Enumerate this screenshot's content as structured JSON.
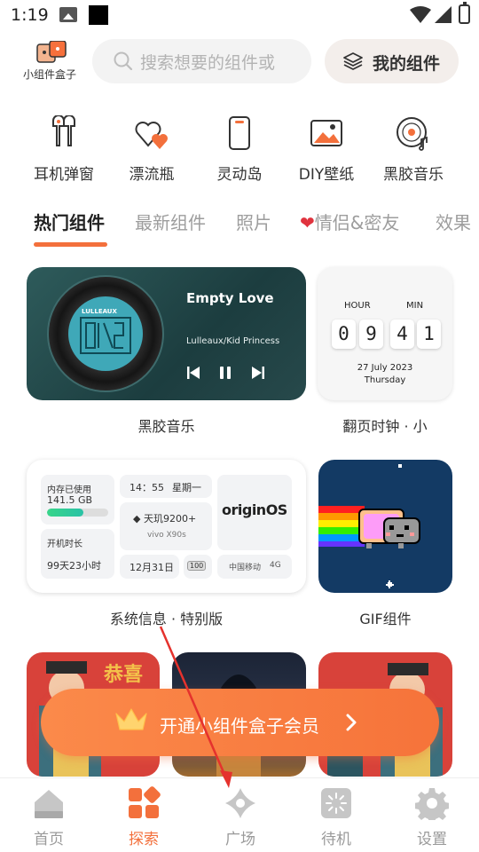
{
  "status_bar": {
    "time": "1:19"
  },
  "header": {
    "logo_label": "小组件盒子",
    "search_placeholder": "搜索想要的组件或",
    "my_widgets_label": "我的组件"
  },
  "categories": [
    {
      "label": "耳机弹窗",
      "icon": "earbuds-icon"
    },
    {
      "label": "漂流瓶",
      "icon": "hearts-icon"
    },
    {
      "label": "灵动岛",
      "icon": "phone-icon"
    },
    {
      "label": "DIY壁纸",
      "icon": "picture-icon"
    },
    {
      "label": "黑胶音乐",
      "icon": "vinyl-record-icon"
    }
  ],
  "tabs": [
    {
      "label": "热门组件",
      "active": true
    },
    {
      "label": "最新组件",
      "active": false
    },
    {
      "label": "照片",
      "active": false
    },
    {
      "label": "情侣&密友",
      "active": false
    },
    {
      "label": "效果",
      "active": false
    }
  ],
  "widgets": {
    "music": {
      "caption": "黑胶音乐",
      "song": "Empty Love",
      "artist": "Lulleaux/Kid Princess",
      "cover_text": "LULLEAUX"
    },
    "flip_clock": {
      "caption": "翻页时钟 · 小",
      "hour_label": "HOUR",
      "min_label": "MIN",
      "digits": [
        "0",
        "9",
        "4",
        "1"
      ],
      "date": "27 July 2023",
      "weekday": "Thursday"
    },
    "sys_info": {
      "caption": "系统信息 · 特别版",
      "storage_label": "内存已使用",
      "storage_value": "141.5 GB",
      "storage_fill": 0.6,
      "uptime_label": "开机时长",
      "uptime_value": "99天23小时",
      "time": "14：55",
      "weekday": "星期一",
      "chip": "天玑9200+",
      "device": "vivo X90s",
      "brand": "originOS",
      "date": "12月31日",
      "battery": "100",
      "carrier": "中国移动",
      "network": "4G"
    },
    "gif": {
      "caption": "GIF组件"
    },
    "row3_left_text": "恭喜"
  },
  "vip_banner": {
    "label": "开通小组件盒子会员"
  },
  "bottom_nav": [
    {
      "label": "首页",
      "icon": "home-icon",
      "active": false
    },
    {
      "label": "探索",
      "icon": "explore-grid-icon",
      "active": true
    },
    {
      "label": "广场",
      "icon": "plaza-icon",
      "active": false
    },
    {
      "label": "待机",
      "icon": "standby-icon",
      "active": false
    },
    {
      "label": "设置",
      "icon": "settings-gear-icon",
      "active": false
    }
  ],
  "colors": {
    "accent": "#f3703c",
    "music_bg": "#23494b",
    "gif_bg": "#133a64",
    "poster_red": "#d8423a"
  }
}
